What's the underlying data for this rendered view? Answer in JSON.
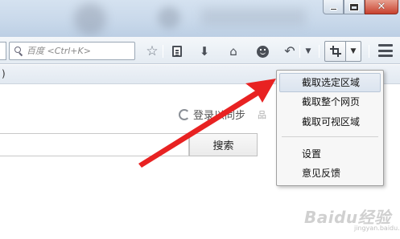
{
  "window": {
    "controls": {
      "minimize_icon": "minimize-icon",
      "maximize_icon": "maximize-icon",
      "close_icon": "close-icon",
      "close_glyph": "✕"
    }
  },
  "toolbar": {
    "search_placeholder": "百度 <Ctrl+K>",
    "icons": [
      "search-icon",
      "star-icon",
      "reading-list-icon",
      "download-icon",
      "home-icon",
      "smiley-icon",
      "undo-icon",
      "chevron-down-icon",
      "crop-icon",
      "chevron-down-icon",
      "hamburger-menu-icon"
    ],
    "star_glyph": "☆",
    "download_glyph": "⬇",
    "home_glyph": "⌂",
    "undo_glyph": "↶",
    "dropdown_glyph": "▼",
    "accent_color": "#e02020"
  },
  "bookmarks": {
    "partial_text": ")"
  },
  "page": {
    "login_sync": "登录以同步",
    "search_button": "搜索"
  },
  "capture_menu": {
    "items": [
      {
        "label": "截取选定区域",
        "highlighted": true
      },
      {
        "label": "截取整个网页",
        "highlighted": false
      },
      {
        "label": "截取可视区域",
        "highlighted": false
      },
      {
        "label": "设置",
        "highlighted": false
      },
      {
        "label": "意见反馈",
        "highlighted": false
      }
    ]
  },
  "watermark": {
    "logo_text": "Baidu经验",
    "sub_text": "jingyan.baidu.com"
  }
}
